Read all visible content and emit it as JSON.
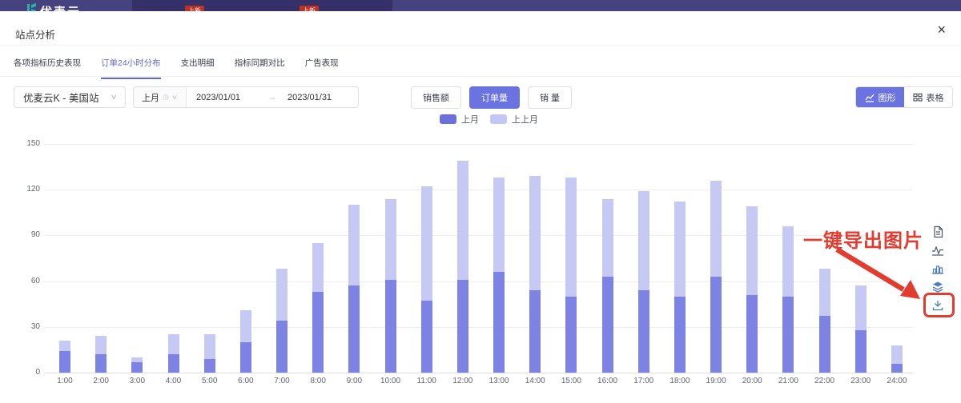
{
  "navbar": {
    "brand": "优麦云",
    "badge1": "上新",
    "badge2": "上新"
  },
  "panel": {
    "title": "站点分析",
    "close": "×"
  },
  "tabs": [
    {
      "label": "各项指标历史表现"
    },
    {
      "label": "订单24小时分布"
    },
    {
      "label": "支出明细"
    },
    {
      "label": "指标同期对比"
    },
    {
      "label": "广告表现"
    }
  ],
  "filters": {
    "site": "优麦云K - 美国站",
    "period": "上月",
    "date_start": "2023/01/01",
    "date_end": "2023/01/31",
    "arrow": "→"
  },
  "metrics": {
    "sales": "销售额",
    "orders": "订单量",
    "volume": "销 量"
  },
  "view_toggle": {
    "chart": "图形",
    "table": "表格"
  },
  "annotation": {
    "text": "一键导出图片",
    "color": "#e23b30"
  },
  "toolbar_icons": [
    "document-icon",
    "trend-icon",
    "bar-chart-icon",
    "layers-icon",
    "download-icon"
  ],
  "chart_data": {
    "type": "bar",
    "stacked": true,
    "title": "",
    "xlabel": "",
    "ylabel": "",
    "ylim": [
      0,
      150
    ],
    "yticks": [
      0,
      30,
      60,
      90,
      120,
      150
    ],
    "grid": true,
    "legend_position": "top-center",
    "categories": [
      "1:00",
      "2:00",
      "3:00",
      "4:00",
      "5:00",
      "6:00",
      "7:00",
      "8:00",
      "9:00",
      "10:00",
      "11:00",
      "12:00",
      "13:00",
      "14:00",
      "15:00",
      "16:00",
      "17:00",
      "18:00",
      "19:00",
      "20:00",
      "21:00",
      "22:00",
      "23:00",
      "24:00"
    ],
    "series": [
      {
        "name": "上月",
        "color": "#7d83e5",
        "legend_color": "#6a70dc",
        "values": [
          14,
          12,
          7,
          12,
          9,
          20,
          34,
          53,
          57,
          61,
          47,
          61,
          66,
          54,
          50,
          63,
          54,
          50,
          63,
          51,
          50,
          37,
          28,
          6
        ]
      },
      {
        "name": "上上月",
        "color": "#c6c9f4",
        "legend_color": "#c3c7f5",
        "values": [
          7,
          12,
          3,
          13,
          16,
          21,
          34,
          32,
          53,
          53,
          75,
          78,
          62,
          75,
          78,
          51,
          65,
          62,
          63,
          58,
          46,
          31,
          29,
          12
        ]
      }
    ]
  }
}
